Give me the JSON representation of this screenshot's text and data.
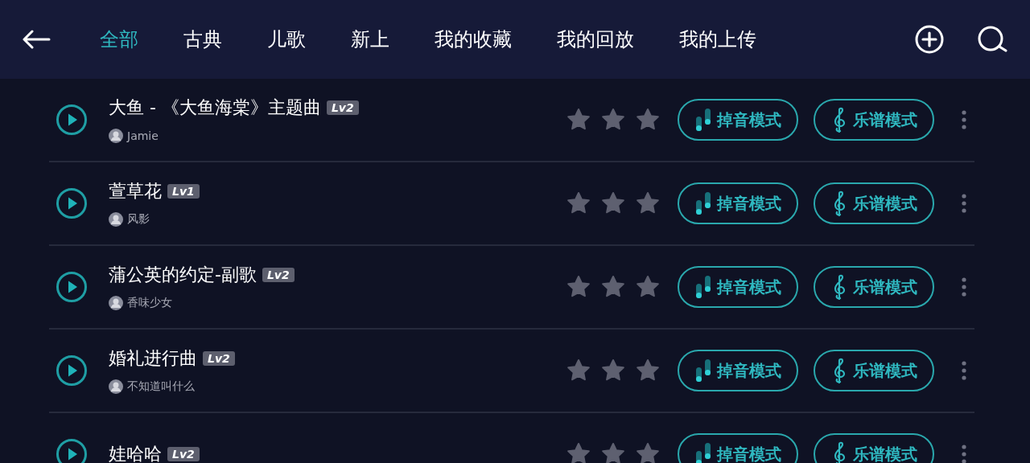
{
  "tabs": [
    {
      "label": "全部",
      "selected": true
    },
    {
      "label": "古典",
      "selected": false
    },
    {
      "label": "儿歌",
      "selected": false
    },
    {
      "label": "新上",
      "selected": false
    },
    {
      "label": "我的收藏",
      "selected": false
    },
    {
      "label": "我的回放",
      "selected": false
    },
    {
      "label": "我的上传",
      "selected": false
    }
  ],
  "songs": [
    {
      "title": "大鱼 - 《大鱼海棠》主题曲",
      "level": "Lv2",
      "author": "Jamie",
      "stars": 0,
      "buttons": [
        "掉音模式",
        "乐谱模式"
      ]
    },
    {
      "title": "萱草花",
      "level": "Lv1",
      "author": "风影",
      "stars": 0,
      "buttons": [
        "掉音模式",
        "乐谱模式"
      ]
    },
    {
      "title": "蒲公英的约定-副歌",
      "level": "Lv2",
      "author": "香味少女",
      "stars": 0,
      "buttons": [
        "掉音模式",
        "乐谱模式"
      ]
    },
    {
      "title": "婚礼进行曲",
      "level": "Lv2",
      "author": "不知道叫什么",
      "stars": 0,
      "buttons": [
        "掉音模式",
        "乐谱模式"
      ]
    },
    {
      "title": "娃哈哈",
      "level": "Lv2",
      "stars": 0,
      "buttons": [
        "掉音模式",
        "乐谱模式"
      ]
    }
  ]
}
